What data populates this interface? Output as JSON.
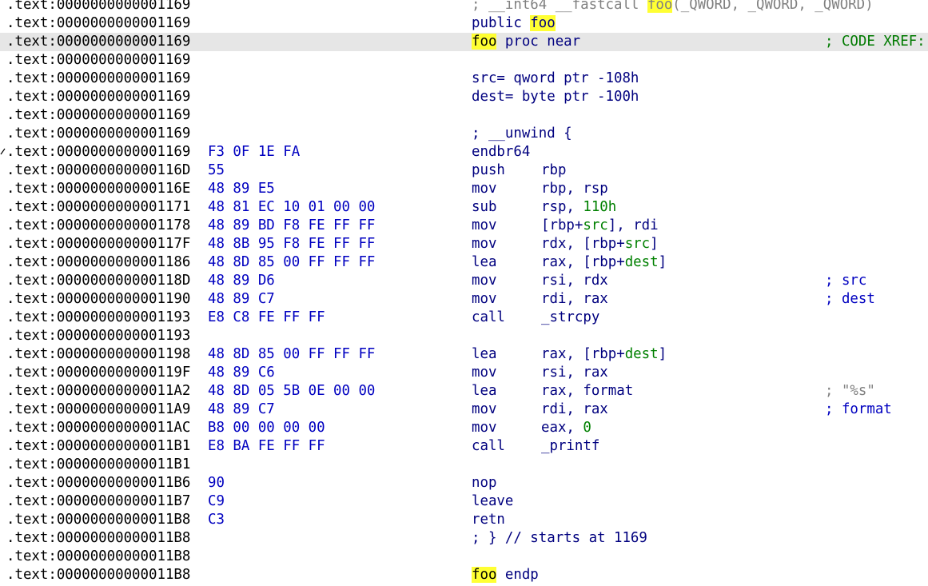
{
  "address_prefix": ".text:",
  "rows": [
    {
      "addr": "0000000000001169",
      "bytes": "",
      "kind": "header",
      "pre": "; __int64 __fastcall ",
      "name": "foo",
      "post": "(_QWORD, _QWORD, _QWORD)"
    },
    {
      "addr": "0000000000001169",
      "bytes": "",
      "kind": "public",
      "keyword": "public ",
      "name": "foo"
    },
    {
      "addr": "0000000000001169",
      "bytes": "",
      "kind": "proc",
      "name": "foo",
      "rest": " proc near",
      "comment": "; CODE XREF:",
      "highlight": true
    },
    {
      "addr": "0000000000001169",
      "bytes": "",
      "kind": "empty"
    },
    {
      "addr": "0000000000001169",
      "bytes": "",
      "kind": "var",
      "text": "src= qword ptr -108h"
    },
    {
      "addr": "0000000000001169",
      "bytes": "",
      "kind": "var",
      "text": "dest= byte ptr -100h"
    },
    {
      "addr": "0000000000001169",
      "bytes": "",
      "kind": "empty"
    },
    {
      "addr": "0000000000001169",
      "bytes": "",
      "kind": "plain",
      "text": "; __unwind {"
    },
    {
      "addr": "0000000000001169",
      "bytes": "F3 0F 1E FA",
      "kind": "insn",
      "mnem": "endbr64",
      "ops": []
    },
    {
      "addr": "000000000000116D",
      "bytes": "55",
      "kind": "insn",
      "mnem": "push",
      "ops": [
        [
          "rbp",
          ""
        ]
      ]
    },
    {
      "addr": "000000000000116E",
      "bytes": "48 89 E5",
      "kind": "insn",
      "mnem": "mov",
      "ops": [
        [
          "rbp, rsp",
          ""
        ]
      ]
    },
    {
      "addr": "0000000000001171",
      "bytes": "48 81 EC 10 01 00 00",
      "kind": "insn",
      "mnem": "sub",
      "ops": [
        [
          "rsp, ",
          ""
        ],
        [
          "110h",
          "green"
        ]
      ]
    },
    {
      "addr": "0000000000001178",
      "bytes": "48 89 BD F8 FE FF FF",
      "kind": "insn",
      "mnem": "mov",
      "ops": [
        [
          "[rbp+",
          ""
        ],
        [
          "src",
          "green"
        ],
        [
          "], rdi",
          ""
        ]
      ]
    },
    {
      "addr": "000000000000117F",
      "bytes": "48 8B 95 F8 FE FF FF",
      "kind": "insn",
      "mnem": "mov",
      "ops": [
        [
          "rdx, [rbp+",
          ""
        ],
        [
          "src",
          "green"
        ],
        [
          "]",
          ""
        ]
      ]
    },
    {
      "addr": "0000000000001186",
      "bytes": "48 8D 85 00 FF FF FF",
      "kind": "insn",
      "mnem": "lea",
      "ops": [
        [
          "rax, [rbp+",
          ""
        ],
        [
          "dest",
          "green"
        ],
        [
          "]",
          ""
        ]
      ]
    },
    {
      "addr": "000000000000118D",
      "bytes": "48 89 D6",
      "kind": "insn",
      "mnem": "mov",
      "ops": [
        [
          "rsi, rdx",
          ""
        ]
      ],
      "comment": "; src"
    },
    {
      "addr": "0000000000001190",
      "bytes": "48 89 C7",
      "kind": "insn",
      "mnem": "mov",
      "ops": [
        [
          "rdi, rax",
          ""
        ]
      ],
      "comment": "; dest"
    },
    {
      "addr": "0000000000001193",
      "bytes": "E8 C8 FE FF FF",
      "kind": "insn",
      "mnem": "call",
      "ops": [
        [
          "_strcpy",
          ""
        ]
      ]
    },
    {
      "addr": "0000000000001193",
      "bytes": "",
      "kind": "empty"
    },
    {
      "addr": "0000000000001198",
      "bytes": "48 8D 85 00 FF FF FF",
      "kind": "insn",
      "mnem": "lea",
      "ops": [
        [
          "rax, [rbp+",
          ""
        ],
        [
          "dest",
          "green"
        ],
        [
          "]",
          ""
        ]
      ]
    },
    {
      "addr": "000000000000119F",
      "bytes": "48 89 C6",
      "kind": "insn",
      "mnem": "mov",
      "ops": [
        [
          "rsi, rax",
          ""
        ]
      ]
    },
    {
      "addr": "00000000000011A2",
      "bytes": "48 8D 05 5B 0E 00 00",
      "kind": "insn",
      "mnem": "lea",
      "ops": [
        [
          "rax, format",
          ""
        ]
      ],
      "comment": "; \"%s\"",
      "comment_style": "gray"
    },
    {
      "addr": "00000000000011A9",
      "bytes": "48 89 C7",
      "kind": "insn",
      "mnem": "mov",
      "ops": [
        [
          "rdi, rax",
          ""
        ]
      ],
      "comment": "; format"
    },
    {
      "addr": "00000000000011AC",
      "bytes": "B8 00 00 00 00",
      "kind": "insn",
      "mnem": "mov",
      "ops": [
        [
          "eax, ",
          ""
        ],
        [
          "0",
          "green"
        ]
      ]
    },
    {
      "addr": "00000000000011B1",
      "bytes": "E8 BA FE FF FF",
      "kind": "insn",
      "mnem": "call",
      "ops": [
        [
          "_printf",
          ""
        ]
      ]
    },
    {
      "addr": "00000000000011B1",
      "bytes": "",
      "kind": "empty"
    },
    {
      "addr": "00000000000011B6",
      "bytes": "90",
      "kind": "insn",
      "mnem": "nop",
      "ops": []
    },
    {
      "addr": "00000000000011B7",
      "bytes": "C9",
      "kind": "insn",
      "mnem": "leave",
      "ops": []
    },
    {
      "addr": "00000000000011B8",
      "bytes": "C3",
      "kind": "insn",
      "mnem": "retn",
      "ops": []
    },
    {
      "addr": "00000000000011B8",
      "bytes": "",
      "kind": "plain",
      "text": "; } // starts at 1169"
    },
    {
      "addr": "00000000000011B8",
      "bytes": "",
      "kind": "empty"
    },
    {
      "addr": "00000000000011B8",
      "bytes": "",
      "kind": "endp",
      "name": "foo",
      "rest": " endp"
    }
  ],
  "colors": {
    "address": "#000000",
    "bytes": "#0000c0",
    "instruction": "#00007f",
    "operand_highlight": "#008000",
    "comment": "#0000c0",
    "string_comment": "#808080",
    "xref_comment": "#007a00",
    "name_highlight": "#ffff33",
    "current_line": "#e6e6e6"
  }
}
